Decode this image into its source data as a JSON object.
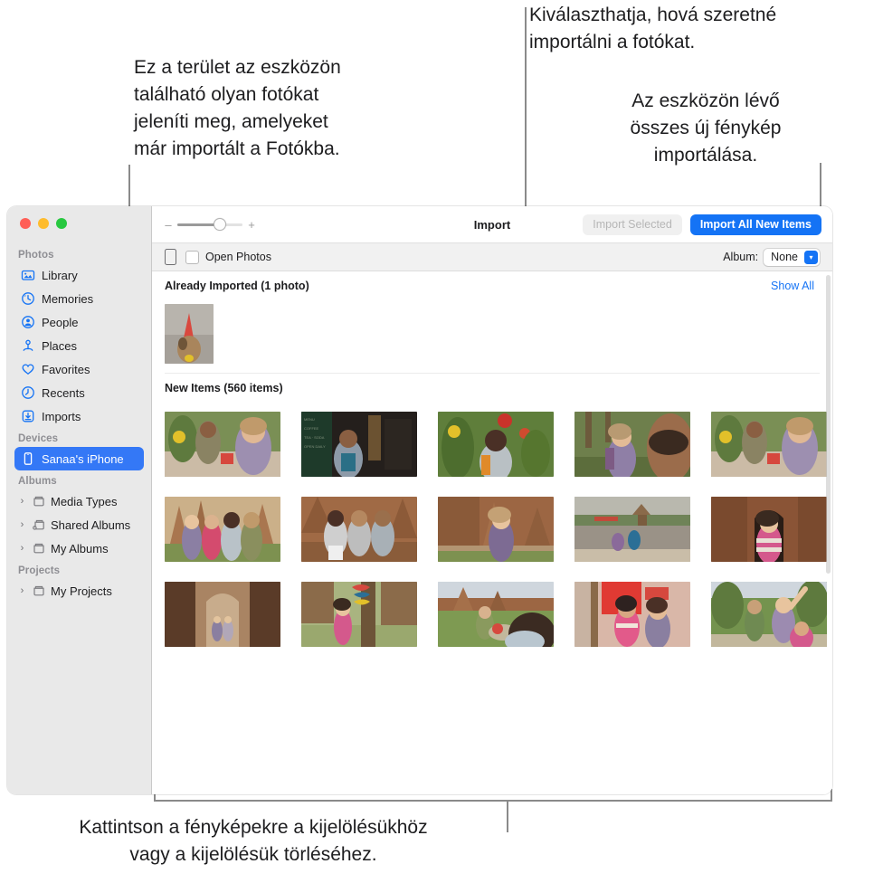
{
  "callouts": {
    "left": "Ez a terület az eszközön\ntalálható olyan fotókat\njeleníti meg, amelyeket\nmár importált a Fotókba.",
    "middle": "Kiválaszthatja, hová szeretné\nimportálni a fotókat.",
    "right": "Az eszközön lévő\nösszes új fénykép\nimportálása.",
    "bottom": "Kattintson a fényképekre a kijelölésükhöz\nvagy a kijelölésük törléséhez."
  },
  "window": {
    "traffic_lights": [
      "close",
      "minimize",
      "zoom"
    ]
  },
  "sidebar": {
    "sections": [
      {
        "title": "Photos",
        "items": [
          {
            "label": "Library",
            "icon": "library-icon",
            "selected": false
          },
          {
            "label": "Memories",
            "icon": "memories-icon",
            "selected": false
          },
          {
            "label": "People",
            "icon": "people-icon",
            "selected": false
          },
          {
            "label": "Places",
            "icon": "places-icon",
            "selected": false
          },
          {
            "label": "Favorites",
            "icon": "heart-icon",
            "selected": false
          },
          {
            "label": "Recents",
            "icon": "clock-icon",
            "selected": false
          },
          {
            "label": "Imports",
            "icon": "import-icon",
            "selected": false
          }
        ]
      },
      {
        "title": "Devices",
        "items": [
          {
            "label": "Sanaa's iPhone",
            "icon": "iphone-icon",
            "selected": true
          }
        ]
      },
      {
        "title": "Albums",
        "items": [
          {
            "label": "Media Types",
            "icon": "folder-icon",
            "disclosure": "›"
          },
          {
            "label": "Shared Albums",
            "icon": "shared-folder-icon",
            "disclosure": "›"
          },
          {
            "label": "My Albums",
            "icon": "folder-icon",
            "disclosure": "›"
          }
        ]
      },
      {
        "title": "Projects",
        "items": [
          {
            "label": "My Projects",
            "icon": "folder-icon",
            "disclosure": "›"
          }
        ]
      }
    ]
  },
  "toolbar": {
    "zoom_minus": "–",
    "zoom_plus": "+",
    "zoom_value": 62,
    "title": "Import",
    "import_selected_label": "Import Selected",
    "import_selected_disabled": true,
    "import_all_label": "Import All New Items"
  },
  "subbar": {
    "device_icon": "iphone-icon",
    "open_photos_label": "Open Photos",
    "open_photos_checked": false,
    "album_label": "Album:",
    "album_value": "None",
    "album_options": [
      "None"
    ],
    "chevron": "▾"
  },
  "content": {
    "already_imported": {
      "title": "Already Imported (1 photo)",
      "show_all_label": "Show All",
      "thumbs": [
        {
          "alt": "dog-with-party-hat",
          "c1": "#b8b4ad",
          "c2": "#8e8a83",
          "accent": "#d9483e",
          "kind": "dog"
        }
      ]
    },
    "new_items": {
      "title": "New Items (560 items)",
      "thumbs": [
        {
          "alt": "two-travelers-walking-path",
          "c1": "#7a8f55",
          "c2": "#cbbba6",
          "accent": "#e2c02a",
          "kind": "outdoor"
        },
        {
          "alt": "man-by-dark-cafe-doorway",
          "c1": "#241f1c",
          "c2": "#4d463f",
          "accent": "#2b6f86",
          "kind": "dark"
        },
        {
          "alt": "man-smiling-among-flowers",
          "c1": "#5f7e3b",
          "c2": "#9fb27a",
          "accent": "#c9332a",
          "kind": "garden"
        },
        {
          "alt": "woman-backpack-palm-trees",
          "c1": "#6e7f4c",
          "c2": "#b3a88e",
          "accent": "#8d7fa2",
          "kind": "outdoor"
        },
        {
          "alt": "travelers-yellow-flowers",
          "c1": "#7a8f55",
          "c2": "#cbbba6",
          "accent": "#e2c02a",
          "kind": "outdoor"
        },
        {
          "alt": "group-at-temple-ruins",
          "c1": "#a9764f",
          "c2": "#cbb089",
          "accent": "#8b6f9c",
          "kind": "temple"
        },
        {
          "alt": "three-friends-sitting-ruins",
          "c1": "#a06a45",
          "c2": "#cfae86",
          "accent": "#c8c2bb",
          "kind": "temple"
        },
        {
          "alt": "woman-walking-brick-temple",
          "c1": "#9c6643",
          "c2": "#c4a47e",
          "accent": "#7d6b93",
          "kind": "temple"
        },
        {
          "alt": "two-people-sitting-by-river",
          "c1": "#a8a59a",
          "c2": "#6f8358",
          "accent": "#c24a3a",
          "kind": "river"
        },
        {
          "alt": "woman-in-temple-archway",
          "c1": "#8a5436",
          "c2": "#b07d55",
          "accent": "#d4598c",
          "kind": "temple"
        },
        {
          "alt": "people-in-temple-corridor",
          "c1": "#6d4a33",
          "c2": "#a98463",
          "accent": "#2b2320",
          "kind": "corridor"
        },
        {
          "alt": "woman-by-tree-with-ribbons",
          "c1": "#8b6b4a",
          "c2": "#a9b480",
          "accent": "#d6483e",
          "kind": "temple"
        },
        {
          "alt": "friends-relaxing-on-grass",
          "c1": "#7e9a52",
          "c2": "#c2b79c",
          "accent": "#3b2b22",
          "kind": "grass"
        },
        {
          "alt": "women-in-tuk-tuk",
          "c1": "#b9574f",
          "c2": "#d9b7a8",
          "accent": "#e03a33",
          "kind": "market"
        },
        {
          "alt": "travelers-waving-by-bikes",
          "c1": "#74934e",
          "c2": "#cdc2a8",
          "accent": "#9c8bb0",
          "kind": "outdoor"
        }
      ]
    }
  },
  "colors": {
    "accent": "#1473f5",
    "selected_row": "#3478f6",
    "sidebar_bg": "#e9e9e9",
    "subbar_bg": "#f1f1f1",
    "callout_line": "#8a8a8a",
    "text": "#1d1d1f",
    "muted": "#8e8e93"
  }
}
